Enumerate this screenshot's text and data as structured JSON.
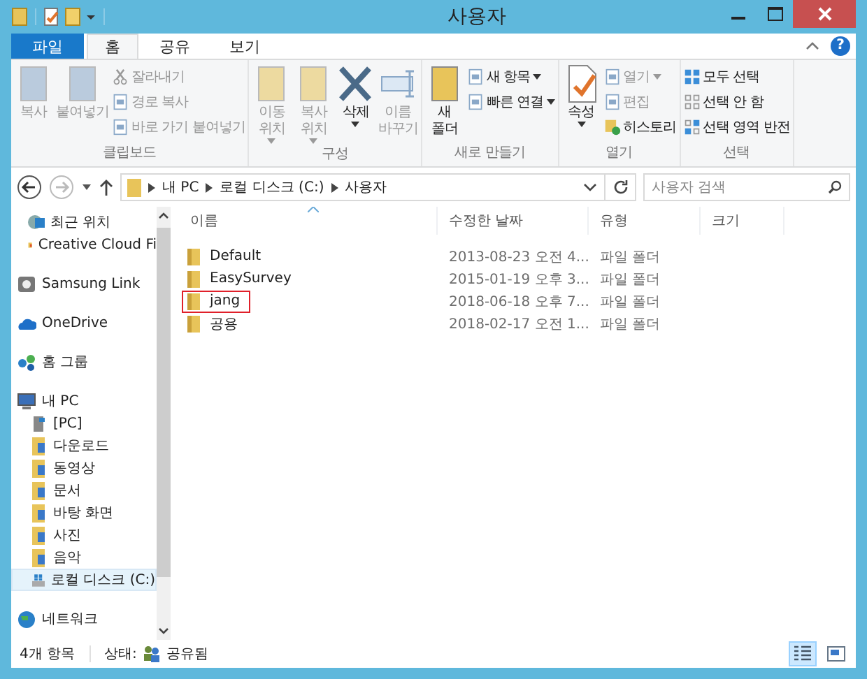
{
  "window": {
    "title": "사용자"
  },
  "ribbon_tabs": [
    {
      "label": "파일",
      "kind": "file",
      "selected": false
    },
    {
      "label": "홈",
      "kind": "tab",
      "selected": true
    },
    {
      "label": "공유",
      "kind": "tab",
      "selected": false
    },
    {
      "label": "보기",
      "kind": "tab",
      "selected": false
    }
  ],
  "ribbon_groups": [
    {
      "label": "클립보드",
      "items": [
        {
          "label": "복사",
          "kind": "large",
          "disabled": true,
          "dropdown": false
        },
        {
          "label": "붙여넣기",
          "kind": "large",
          "disabled": true,
          "dropdown": false
        },
        {
          "label": "잘라내기",
          "kind": "small",
          "disabled": true,
          "dropdown": false
        },
        {
          "label": "경로 복사",
          "kind": "small",
          "disabled": true,
          "dropdown": false
        },
        {
          "label": "바로 가기 붙여넣기",
          "kind": "small",
          "disabled": true,
          "dropdown": false
        }
      ]
    },
    {
      "label": "구성",
      "items": [
        {
          "label": "이동 위치",
          "kind": "large",
          "disabled": true,
          "dropdown": true
        },
        {
          "label": "복사 위치",
          "kind": "large",
          "disabled": true,
          "dropdown": true
        },
        {
          "label": "삭제",
          "kind": "large",
          "disabled": false,
          "dropdown": true
        },
        {
          "label": "이름 바꾸기",
          "kind": "large",
          "disabled": true,
          "dropdown": false
        }
      ]
    },
    {
      "label": "새로 만들기",
      "items": [
        {
          "label": "새 폴더",
          "kind": "large",
          "disabled": false,
          "dropdown": false
        },
        {
          "label": "새 항목",
          "kind": "small",
          "disabled": false,
          "dropdown": true
        },
        {
          "label": "빠른 연결",
          "kind": "small",
          "disabled": false,
          "dropdown": true
        }
      ]
    },
    {
      "label": "열기",
      "items": [
        {
          "label": "속성",
          "kind": "large",
          "disabled": false,
          "dropdown": true
        },
        {
          "label": "열기",
          "kind": "small",
          "disabled": true,
          "dropdown": true
        },
        {
          "label": "편집",
          "kind": "small",
          "disabled": true,
          "dropdown": false
        },
        {
          "label": "히스토리",
          "kind": "small",
          "disabled": false,
          "dropdown": false
        }
      ]
    },
    {
      "label": "선택",
      "items": [
        {
          "label": "모두 선택",
          "kind": "small",
          "disabled": false,
          "dropdown": false
        },
        {
          "label": "선택 안 함",
          "kind": "small",
          "disabled": false,
          "dropdown": false
        },
        {
          "label": "선택 영역 반전",
          "kind": "small",
          "disabled": false,
          "dropdown": false
        }
      ]
    }
  ],
  "help_button": "?",
  "address_bar": {
    "path": [
      "내 PC",
      "로컬 디스크 (C:)",
      "사용자"
    ]
  },
  "search": {
    "placeholder": "사용자 검색"
  },
  "sidebar": {
    "items": [
      {
        "children": [
          {
            "label": "최근 위치",
            "selected": false
          },
          {
            "label": "Creative Cloud Fi",
            "selected": false
          }
        ]
      },
      {
        "label": "Samsung Link",
        "selected": false
      },
      {
        "label": "OneDrive",
        "selected": false
      },
      {
        "label": "홈 그룹",
        "selected": false
      },
      {
        "label": "내 PC",
        "selected": false,
        "children": [
          {
            "label": "[PC]",
            "selected": false
          },
          {
            "label": "다운로드",
            "selected": false
          },
          {
            "label": "동영상",
            "selected": false
          },
          {
            "label": "문서",
            "selected": false
          },
          {
            "label": "바탕 화면",
            "selected": false
          },
          {
            "label": "사진",
            "selected": false
          },
          {
            "label": "음악",
            "selected": false
          },
          {
            "label": "로컬 디스크 (C:)",
            "selected": true
          }
        ]
      },
      {
        "label": "네트워크",
        "selected": false
      }
    ]
  },
  "table": {
    "columns": [
      {
        "label": "이름",
        "sorted": true
      },
      {
        "label": "수정한 날짜",
        "sorted": false
      },
      {
        "label": "유형",
        "sorted": false
      },
      {
        "label": "크기",
        "sorted": false
      }
    ],
    "rows": [
      {
        "name": "Default",
        "modified": "2013-08-23 오전 4...",
        "type": "파일 폴더",
        "highlighted": false
      },
      {
        "name": "EasySurvey",
        "modified": "2015-01-19 오후 3...",
        "type": "파일 폴더",
        "highlighted": false
      },
      {
        "name": "jang",
        "modified": "2018-06-18 오후 7...",
        "type": "파일 폴더",
        "highlighted": true
      },
      {
        "name": "공용",
        "modified": "2018-02-17 오전 1...",
        "type": "파일 폴더",
        "highlighted": false
      }
    ]
  },
  "status_bar": {
    "item_count": "4개 항목",
    "state_label": "상태:",
    "state_value": "공유됨"
  },
  "view_buttons": [
    {
      "kind": "details",
      "selected": true
    },
    {
      "kind": "large_icons",
      "selected": false
    }
  ]
}
